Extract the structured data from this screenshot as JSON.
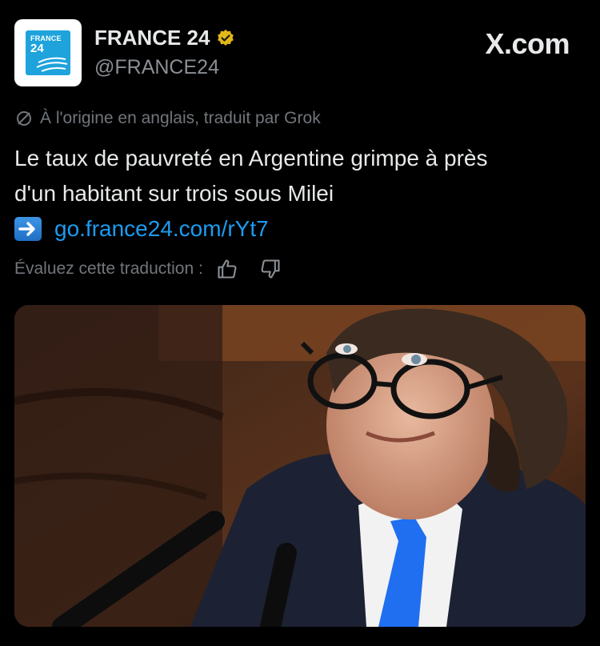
{
  "account": {
    "name": "FRANCE 24",
    "handle": "@FRANCE24",
    "logo_line1": "FRANCE",
    "logo_line2": "24",
    "verified": "gold-verified-badge-icon"
  },
  "brand": "X.com",
  "tweet": {
    "translation_note": "À l'origine en anglais, traduit par Grok",
    "text_line1": "Le taux de pauvreté en Argentine grimpe à près",
    "text_line2": "d'un habitant sur trois sous Milei",
    "link": "go.france24.com/rYt7",
    "rate_label": "Évaluez cette traduction :"
  },
  "colors": {
    "background": "#000000",
    "text": "#e7e9ea",
    "muted": "#71767b",
    "link": "#1d9bf0",
    "logo_blue": "#1ea3dc",
    "badge_gold": "#e2b719"
  },
  "icons": [
    "grok-translate-icon",
    "arrow-right-emoji",
    "thumbs-up-icon",
    "thumbs-down-icon"
  ]
}
